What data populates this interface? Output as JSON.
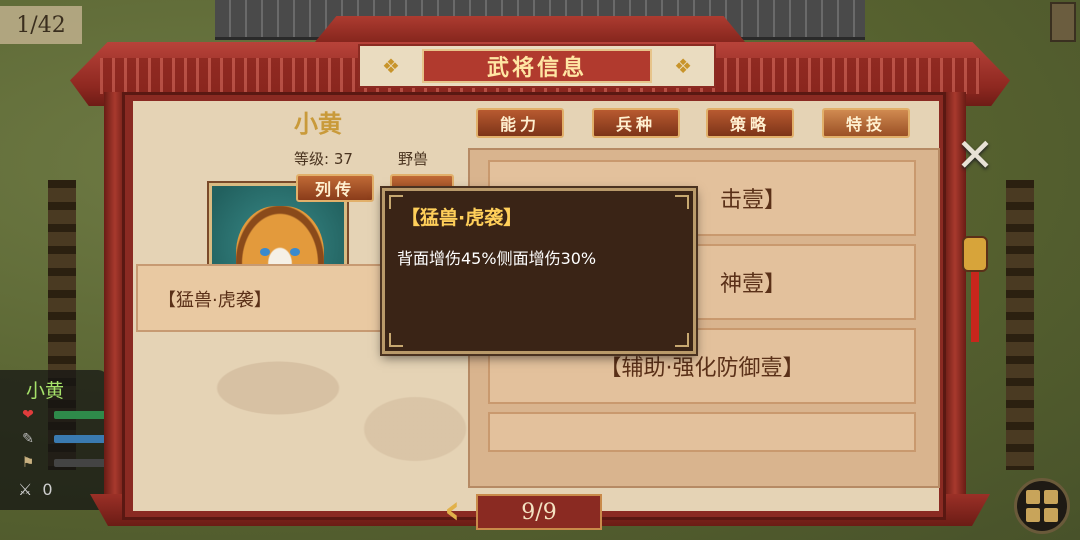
{
  "map": {
    "counter": "1/42"
  },
  "unit_panel": {
    "name": "小黄",
    "hp_icon": "heart-icon",
    "move_icon": "feather-icon",
    "morale_icon": "banner-icon",
    "count_icon": "sword-icon",
    "count": "0"
  },
  "modal": {
    "title": "武将信息",
    "hero": {
      "name": "小黄",
      "level": "等级: 37",
      "type": "野兽",
      "bio_button": "列传"
    },
    "tabs": [
      {
        "label": "能力"
      },
      {
        "label": "兵种"
      },
      {
        "label": "策略"
      },
      {
        "label": "特技"
      }
    ],
    "active_tab": "特技",
    "left_skill": "【猛兽·虎袭】",
    "skill_list": [
      {
        "label": "击壹】"
      },
      {
        "label": "神壹】"
      },
      {
        "label": "【辅助·强化防御壹】"
      }
    ],
    "tooltip": {
      "title": "【猛兽·虎袭】",
      "description": "背面增伤45%侧面增伤30%"
    },
    "pagination": "9/9"
  },
  "colors": {
    "frame_red": "#8a2a22",
    "paper": "#e5d3b5",
    "gold": "#e1b14a",
    "tooltip_bg": "#3a2416",
    "tooltip_title": "#ffcf5a"
  }
}
